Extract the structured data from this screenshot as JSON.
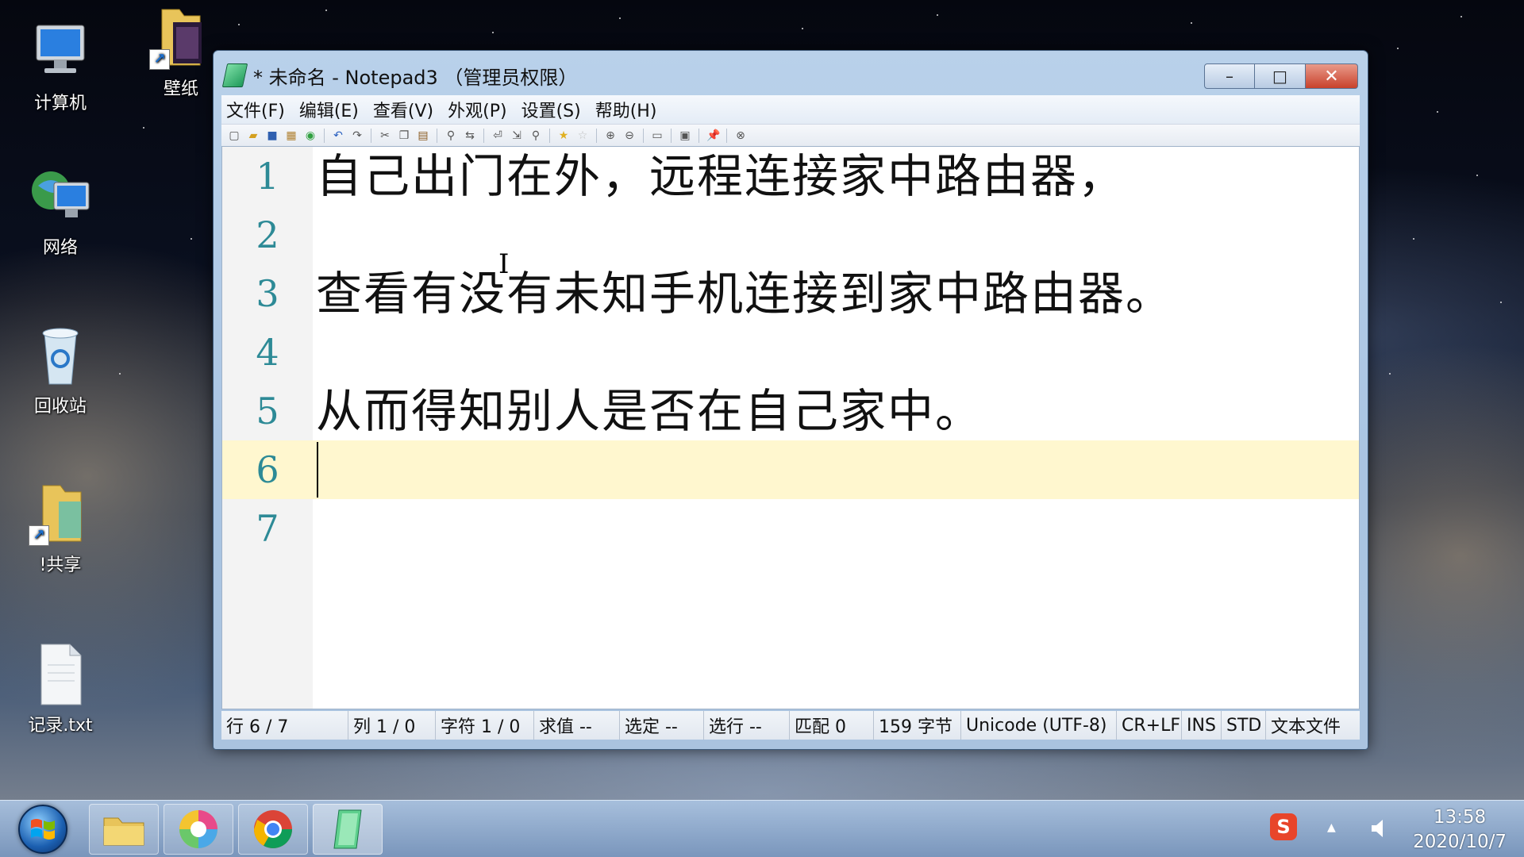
{
  "desktop": {
    "icons": [
      {
        "label": "计算机",
        "icon": "computer-icon"
      },
      {
        "label": "壁纸",
        "icon": "folder-shortcut-icon"
      },
      {
        "label": "网络",
        "icon": "network-icon"
      },
      {
        "label": "回收站",
        "icon": "recycle-bin-icon"
      },
      {
        "label": "!共享",
        "icon": "folder-shortcut-icon"
      },
      {
        "label": "记录.txt",
        "icon": "text-file-icon"
      }
    ]
  },
  "window": {
    "title": "* 未命名 - Notepad3 （管理员权限）",
    "min_label": "–",
    "max_label": "□",
    "close_label": "✕"
  },
  "menu": {
    "items": [
      "文件(F)",
      "编辑(E)",
      "查看(V)",
      "外观(P)",
      "设置(S)",
      "帮助(H)"
    ]
  },
  "editor": {
    "lines": [
      {
        "num": "1",
        "text": "自己出门在外，远程连接家中路由器，"
      },
      {
        "num": "2",
        "text": ""
      },
      {
        "num": "3",
        "text": "查看有没有未知手机连接到家中路由器。"
      },
      {
        "num": "4",
        "text": ""
      },
      {
        "num": "5",
        "text": "从而得知别人是否在自己家中。"
      },
      {
        "num": "6",
        "text": ""
      },
      {
        "num": "7",
        "text": ""
      }
    ],
    "current_line": 6
  },
  "status": {
    "line": "行  6 / 7",
    "col": "列  1 / 0",
    "chars": "字符  1 / 0",
    "eval": "求值  --",
    "sel": "选定  --",
    "sel_lines": "选行  --",
    "match": "匹配  0",
    "bytes": "159 字节",
    "encoding": "Unicode (UTF-8)",
    "eol": "CR+LF",
    "ins": "INS",
    "std": "STD",
    "filetype": "文本文件"
  },
  "taskbar": {
    "clock_time": "13:58",
    "clock_date": "2020/10/7",
    "ime_label": "S",
    "tray_arrow": "▲",
    "volume_icon": "speaker-icon"
  },
  "colors": {
    "line_number": "#2d8a96",
    "current_line_bg": "#fff7cf",
    "close_button": "#c8412b"
  }
}
